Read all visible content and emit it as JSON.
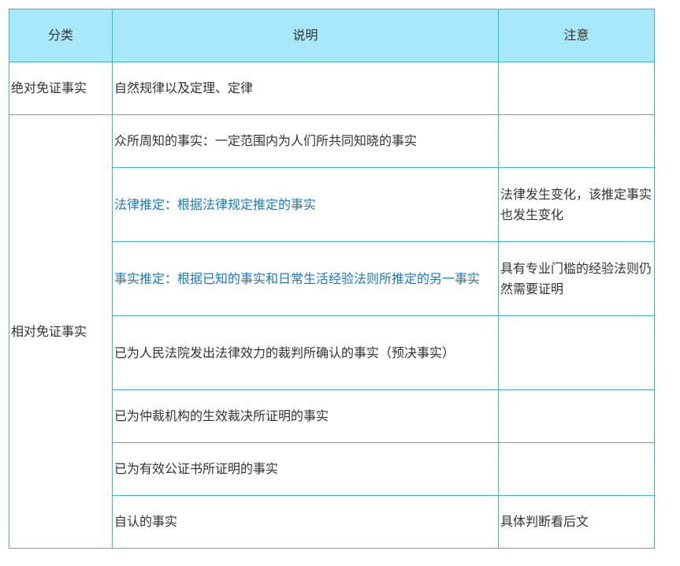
{
  "headers": [
    "分类",
    "说明",
    "注意"
  ],
  "rows": [
    {
      "category": "绝对免证事实",
      "description": "自然规律以及定理、定律",
      "note": ""
    },
    {
      "category": "相对免证事实",
      "description": "众所周知的事实：一定范围内为人们所共同知晓的事实",
      "note": ""
    },
    {
      "description": "法律推定：根据法律规定推定的事实",
      "note": "法律发生变化，该推定事实也发生变化"
    },
    {
      "description": "事实推定：根据已知的事实和日常生活经验法则所推定的另一事实",
      "note": "具有专业门槛的经验法则仍然需要证明"
    },
    {
      "description": "已为人民法院发出法律效力的裁判所确认的事实（预决事实）",
      "note": ""
    },
    {
      "description": "已为仲裁机构的生效裁决所证明的事实",
      "note": ""
    },
    {
      "description": "已为有效公证书所证明的事实",
      "note": ""
    },
    {
      "description": "自认的事实",
      "note": "具体判断看后文"
    }
  ],
  "colors": {
    "header_bg": "#a8e8fb",
    "border": "#3fb7d4",
    "highlight_text": "#1a7ac0"
  }
}
